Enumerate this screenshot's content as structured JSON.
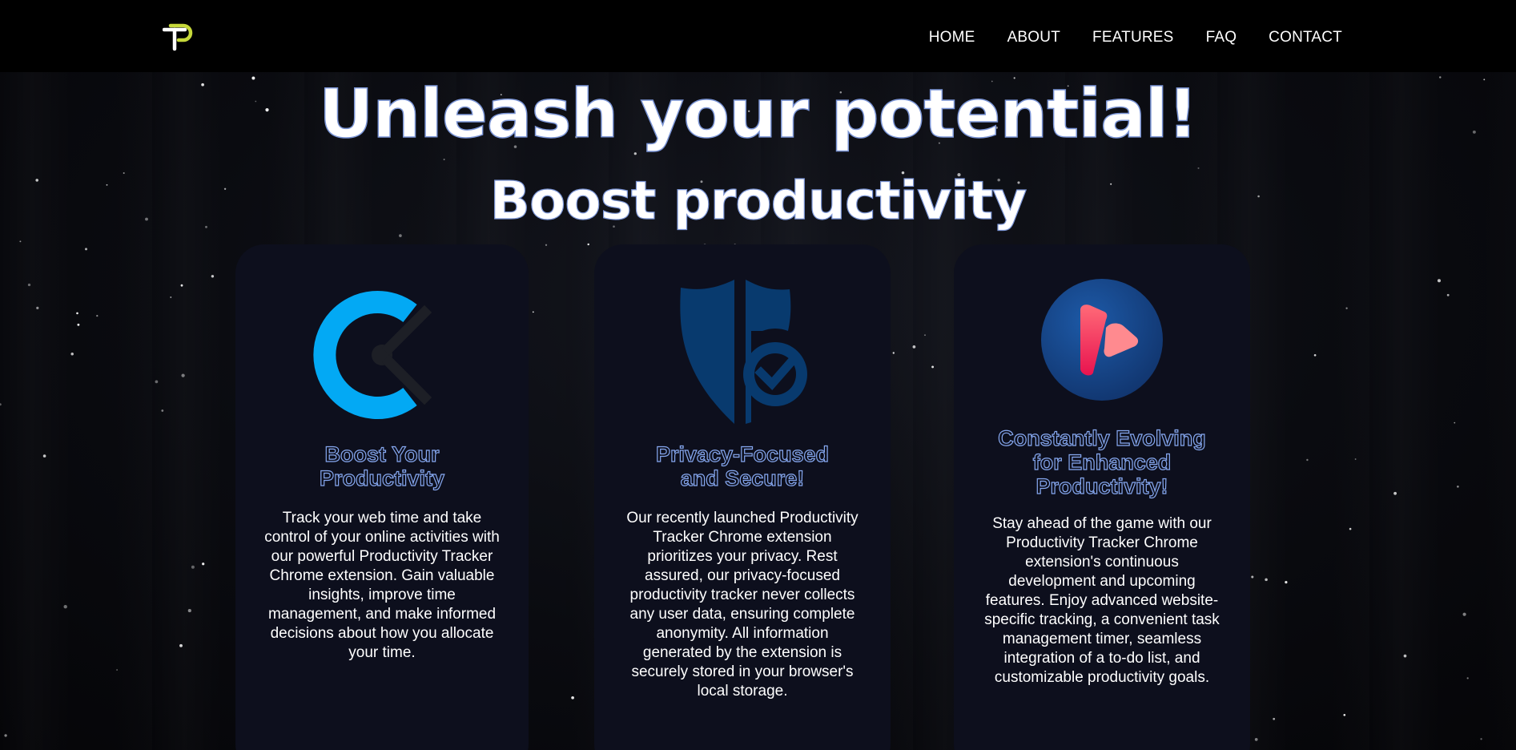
{
  "header": {
    "logo_alt": "TP",
    "nav": [
      "HOME",
      "ABOUT",
      "FEATURES",
      "FAQ",
      "CONTACT"
    ]
  },
  "hero": {
    "title": "Unleash your potential!",
    "subtitle": "Boost productivity"
  },
  "cards": [
    {
      "icon": "clock-logo-icon",
      "title": "Boost Your\nProductivity",
      "text": "Track your web time and take control of your online activities with our powerful Productivity Tracker Chrome extension. Gain valuable insights, improve time management, and make informed decisions about how you allocate your time."
    },
    {
      "icon": "shield-check-icon",
      "title": "Privacy-Focused\nand Secure!",
      "text": "Our recently launched Productivity Tracker Chrome extension prioritizes your privacy. Rest assured, our privacy-focused productivity tracker never collects any user data, ensuring complete anonymity. All information generated by the extension is securely stored in your browser's local storage."
    },
    {
      "icon": "play-logo-icon",
      "title": "Constantly Evolving\nfor Enhanced\nProductivity!",
      "text": "Stay ahead of the game with our Productivity Tracker Chrome extension's continuous development and upcoming features. Enjoy advanced website-specific tracking, a convenient task management timer, seamless integration of a to-do list, and customizable productivity goals."
    }
  ],
  "colors": {
    "accent_lime": "#c6d83a",
    "title_outline": "#7b95d6",
    "card_bg": "#0d0f1d",
    "clock_blue": "#03a9f4",
    "shield_blue": "#083a6e",
    "play_gradient_start": "#ff5a6e",
    "play_gradient_end": "#e8134f"
  }
}
